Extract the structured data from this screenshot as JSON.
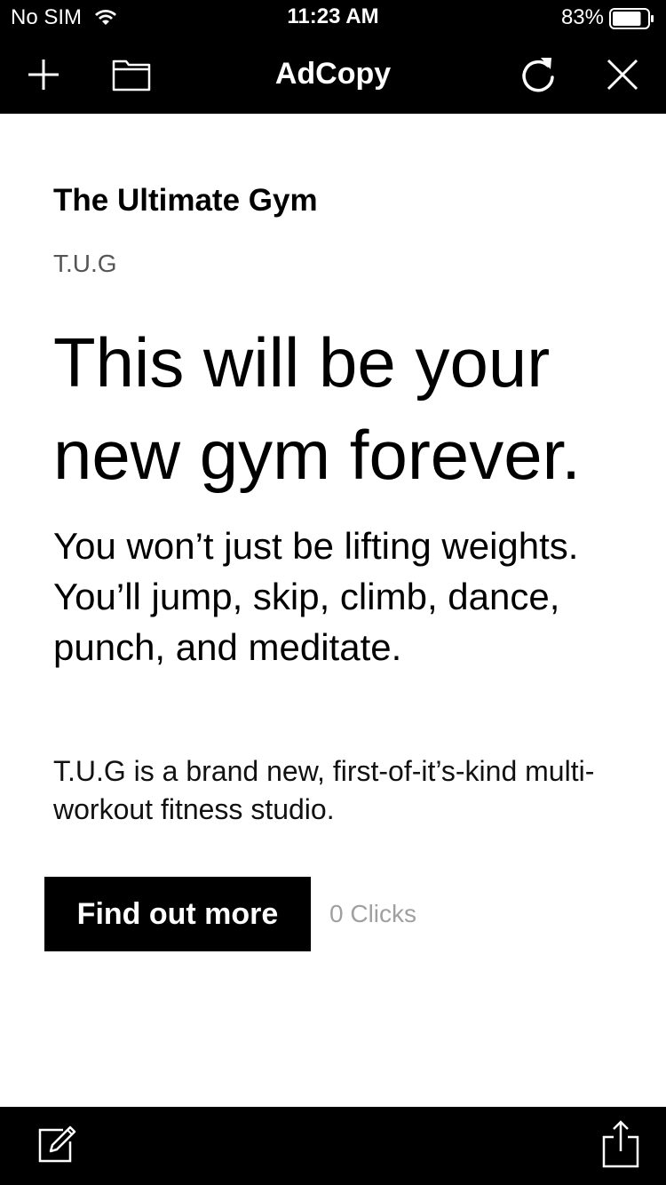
{
  "status_bar": {
    "carrier": "No SIM",
    "time": "11:23 AM",
    "battery_percent": "83%",
    "battery_level": 0.83,
    "icons": [
      "wifi-icon",
      "battery-icon"
    ]
  },
  "nav_bar": {
    "title": "AdCopy",
    "left_icons": [
      "plus-icon",
      "folder-icon"
    ],
    "right_icons": [
      "refresh-icon",
      "close-icon"
    ]
  },
  "ad": {
    "headline": "The Ultimate Gym",
    "brand": "T.U.G",
    "hero_line1": "This will be your",
    "hero_line2": "new gym forever.",
    "subhead": "You won’t just be lifting weights. You’ll jump, skip, climb, dance, punch, and meditate.",
    "body": "T.U.G is a brand new, first-of-it’s-kind multi-workout fitness studio.",
    "cta_label": "Find out more",
    "clicks_text": "0 Clicks"
  },
  "toolbar": {
    "left_icon": "edit-icon",
    "right_icon": "share-icon"
  },
  "colors": {
    "bar_background": "#000000",
    "page_background": "#ffffff",
    "cta_background": "#000000",
    "muted_text": "#a0a0a0"
  }
}
